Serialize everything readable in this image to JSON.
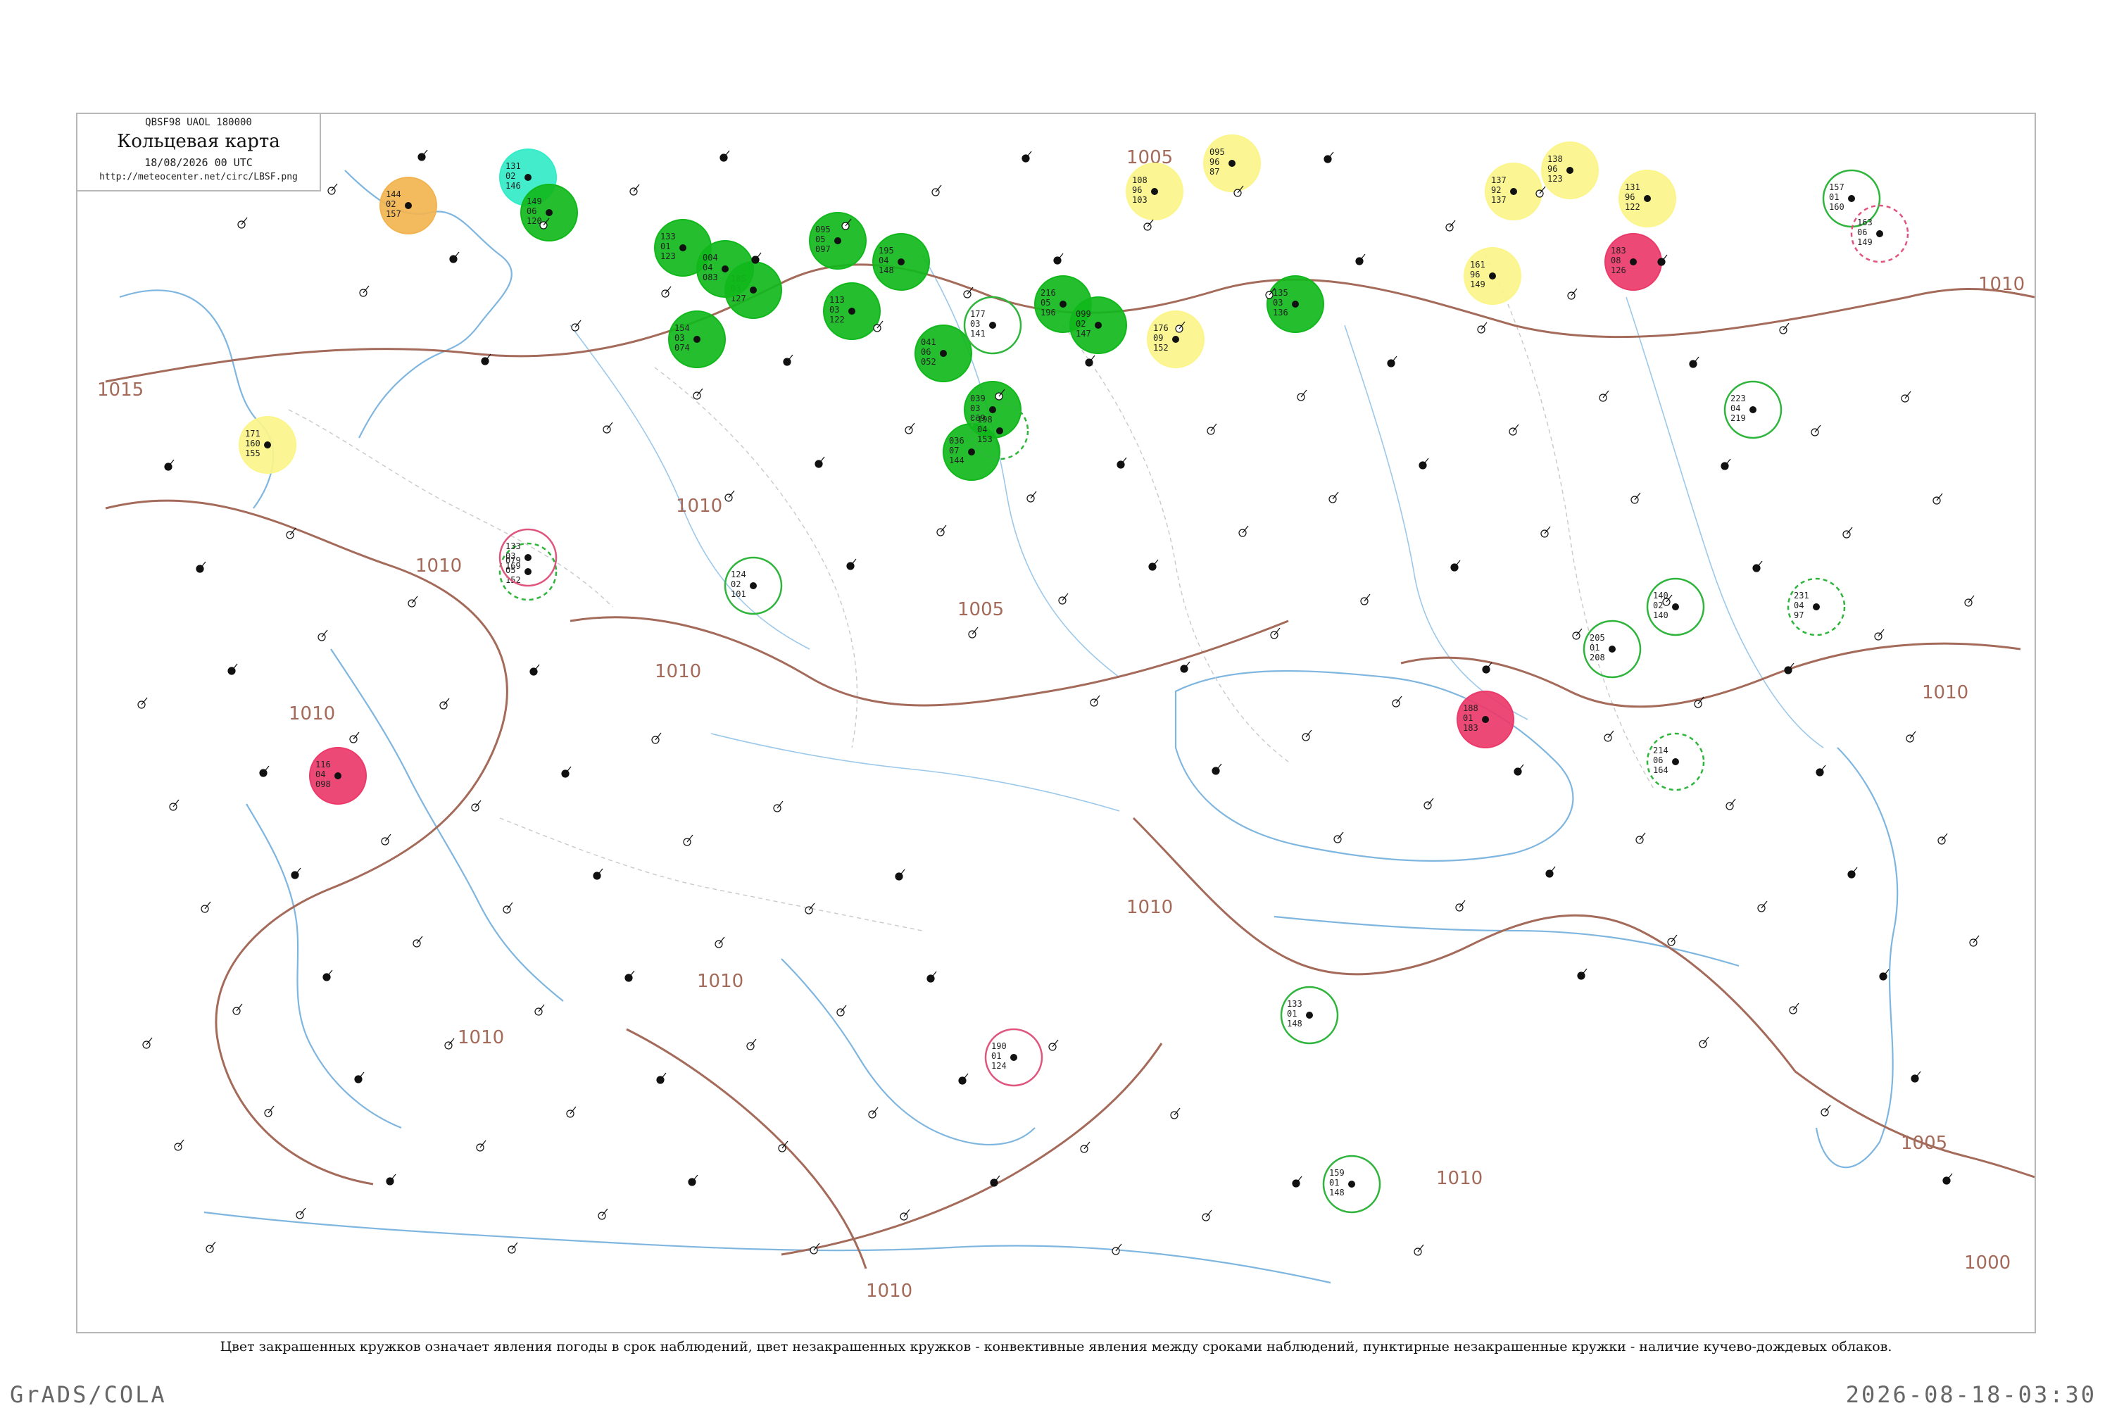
{
  "header": {
    "code": "QBSF98  UAOL  180000",
    "title": "Кольцевая карта",
    "date": "18/08/2026 00 UTC",
    "url": "http://meteocenter.net/circ/LBSF.png"
  },
  "legend_note": "Цвет закрашенных кружков означает явления погоды в срок наблюдений, цвет незакрашенных кружков - конвективные явления между сроками наблюдений, пунктирные незакрашенные кружки - наличие кучево-дождевых облаков.",
  "footer": {
    "left": "GrADS/COLA",
    "right": "2026-08-18-03:30"
  },
  "colors": {
    "green": "#11b81c",
    "yellow": "#fbf58a",
    "red": "#ec3a6a",
    "orange": "#f2b450",
    "cyan": "#33ecc8",
    "open_green": "#2fb53c",
    "open_red": "#e0557e",
    "isobar": "#a46a5a",
    "coast": "#7fb6e0"
  },
  "isobar_labels": [
    {
      "text": "1010"
    },
    {
      "text": "1005"
    },
    {
      "text": "1015"
    },
    {
      "text": "1010"
    },
    {
      "text": "1010"
    },
    {
      "text": "1005"
    },
    {
      "text": "1010"
    },
    {
      "text": "1010"
    },
    {
      "text": "1010"
    },
    {
      "text": "1010"
    },
    {
      "text": "1010"
    },
    {
      "text": "1005"
    },
    {
      "text": "1000"
    },
    {
      "text": "1010"
    },
    {
      "text": "1010"
    },
    {
      "text": "1010"
    }
  ],
  "marker_types": [
    "filled",
    "open",
    "dashed"
  ],
  "stations": [
    {
      "a": "144",
      "b": "02",
      "c": "157",
      "kind": "filled",
      "color": "orange"
    },
    {
      "a": "131",
      "b": "02",
      "c": "146",
      "kind": "filled",
      "color": "cyan"
    },
    {
      "a": "149",
      "b": "06",
      "c": "120",
      "kind": "filled",
      "color": "green"
    },
    {
      "a": "133",
      "b": "01",
      "c": "123",
      "kind": "filled",
      "color": "green"
    },
    {
      "a": "185",
      "b": "03",
      "c": "127",
      "kind": "filled",
      "color": "green"
    },
    {
      "a": "095",
      "b": "05",
      "c": "097",
      "kind": "filled",
      "color": "green"
    },
    {
      "a": "041",
      "b": "06",
      "c": "052",
      "kind": "filled",
      "color": "green"
    },
    {
      "a": "039",
      "b": "03",
      "c": "069",
      "kind": "filled",
      "color": "green"
    },
    {
      "a": "036",
      "b": "07",
      "c": "144",
      "kind": "filled",
      "color": "green"
    },
    {
      "a": "004",
      "b": "04",
      "c": "083",
      "kind": "filled",
      "color": "green"
    },
    {
      "a": "171",
      "b": "160",
      "c": "155",
      "kind": "filled",
      "color": "yellow"
    },
    {
      "a": "183",
      "b": "08",
      "c": "126",
      "kind": "filled",
      "color": "red"
    },
    {
      "a": "095",
      "b": "96",
      "c": "87",
      "kind": "filled",
      "color": "yellow"
    },
    {
      "a": "108",
      "b": "96",
      "c": "103",
      "kind": "filled",
      "color": "yellow"
    },
    {
      "a": "137",
      "b": "92",
      "c": "137",
      "kind": "filled",
      "color": "yellow"
    },
    {
      "a": "138",
      "b": "96",
      "c": "123",
      "kind": "filled",
      "color": "yellow"
    },
    {
      "a": "131",
      "b": "96",
      "c": "122",
      "kind": "filled",
      "color": "yellow"
    },
    {
      "a": "161",
      "b": "96",
      "c": "149",
      "kind": "filled",
      "color": "yellow"
    },
    {
      "a": "176",
      "b": "09",
      "c": "152",
      "kind": "filled",
      "color": "yellow"
    },
    {
      "a": "116",
      "b": "04",
      "c": "098",
      "kind": "filled",
      "color": "red"
    },
    {
      "a": "188",
      "b": "01",
      "c": "183",
      "kind": "filled",
      "color": "red"
    },
    {
      "a": "113",
      "b": "03",
      "c": "122",
      "kind": "filled",
      "color": "green"
    },
    {
      "a": "216",
      "b": "05",
      "c": "196",
      "kind": "filled",
      "color": "green"
    },
    {
      "a": "099",
      "b": "02",
      "c": "147",
      "kind": "filled",
      "color": "green"
    },
    {
      "a": "135",
      "b": "03",
      "c": "136",
      "kind": "filled",
      "color": "green"
    },
    {
      "a": "195",
      "b": "04",
      "c": "148",
      "kind": "filled",
      "color": "green"
    },
    {
      "a": "154",
      "b": "03",
      "c": "074",
      "kind": "filled",
      "color": "green"
    },
    {
      "a": "177",
      "b": "03",
      "c": "141",
      "kind": "open",
      "color": "open_green"
    },
    {
      "a": "198",
      "b": "04",
      "c": "153",
      "kind": "dashed",
      "color": "open_green"
    },
    {
      "a": "124",
      "b": "02",
      "c": "101",
      "kind": "open",
      "color": "open_green"
    },
    {
      "a": "079",
      "b": "05",
      "c": "152",
      "kind": "dashed",
      "color": "open_green"
    },
    {
      "a": "133",
      "b": "03",
      "c": "169",
      "kind": "open",
      "color": "open_red"
    },
    {
      "a": "133",
      "b": "01",
      "c": "148",
      "kind": "open",
      "color": "open_green"
    },
    {
      "a": "140",
      "b": "02",
      "c": "140",
      "kind": "open",
      "color": "open_green"
    },
    {
      "a": "231",
      "b": "04",
      "c": "97",
      "kind": "dashed",
      "color": "open_green"
    },
    {
      "a": "214",
      "b": "06",
      "c": "164",
      "kind": "dashed",
      "color": "open_green"
    },
    {
      "a": "157",
      "b": "01",
      "c": "160",
      "kind": "open",
      "color": "open_green"
    },
    {
      "a": "163",
      "b": "06",
      "c": "149",
      "kind": "dashed",
      "color": "open_red"
    },
    {
      "a": "190",
      "b": "01",
      "c": "124",
      "kind": "open",
      "color": "open_red"
    },
    {
      "a": "159",
      "b": "01",
      "c": "148",
      "kind": "open",
      "color": "open_green"
    },
    {
      "a": "205",
      "b": "01",
      "c": "208",
      "kind": "open",
      "color": "open_green"
    },
    {
      "a": "223",
      "b": "04",
      "c": "219",
      "kind": "open",
      "color": "open_green"
    }
  ]
}
